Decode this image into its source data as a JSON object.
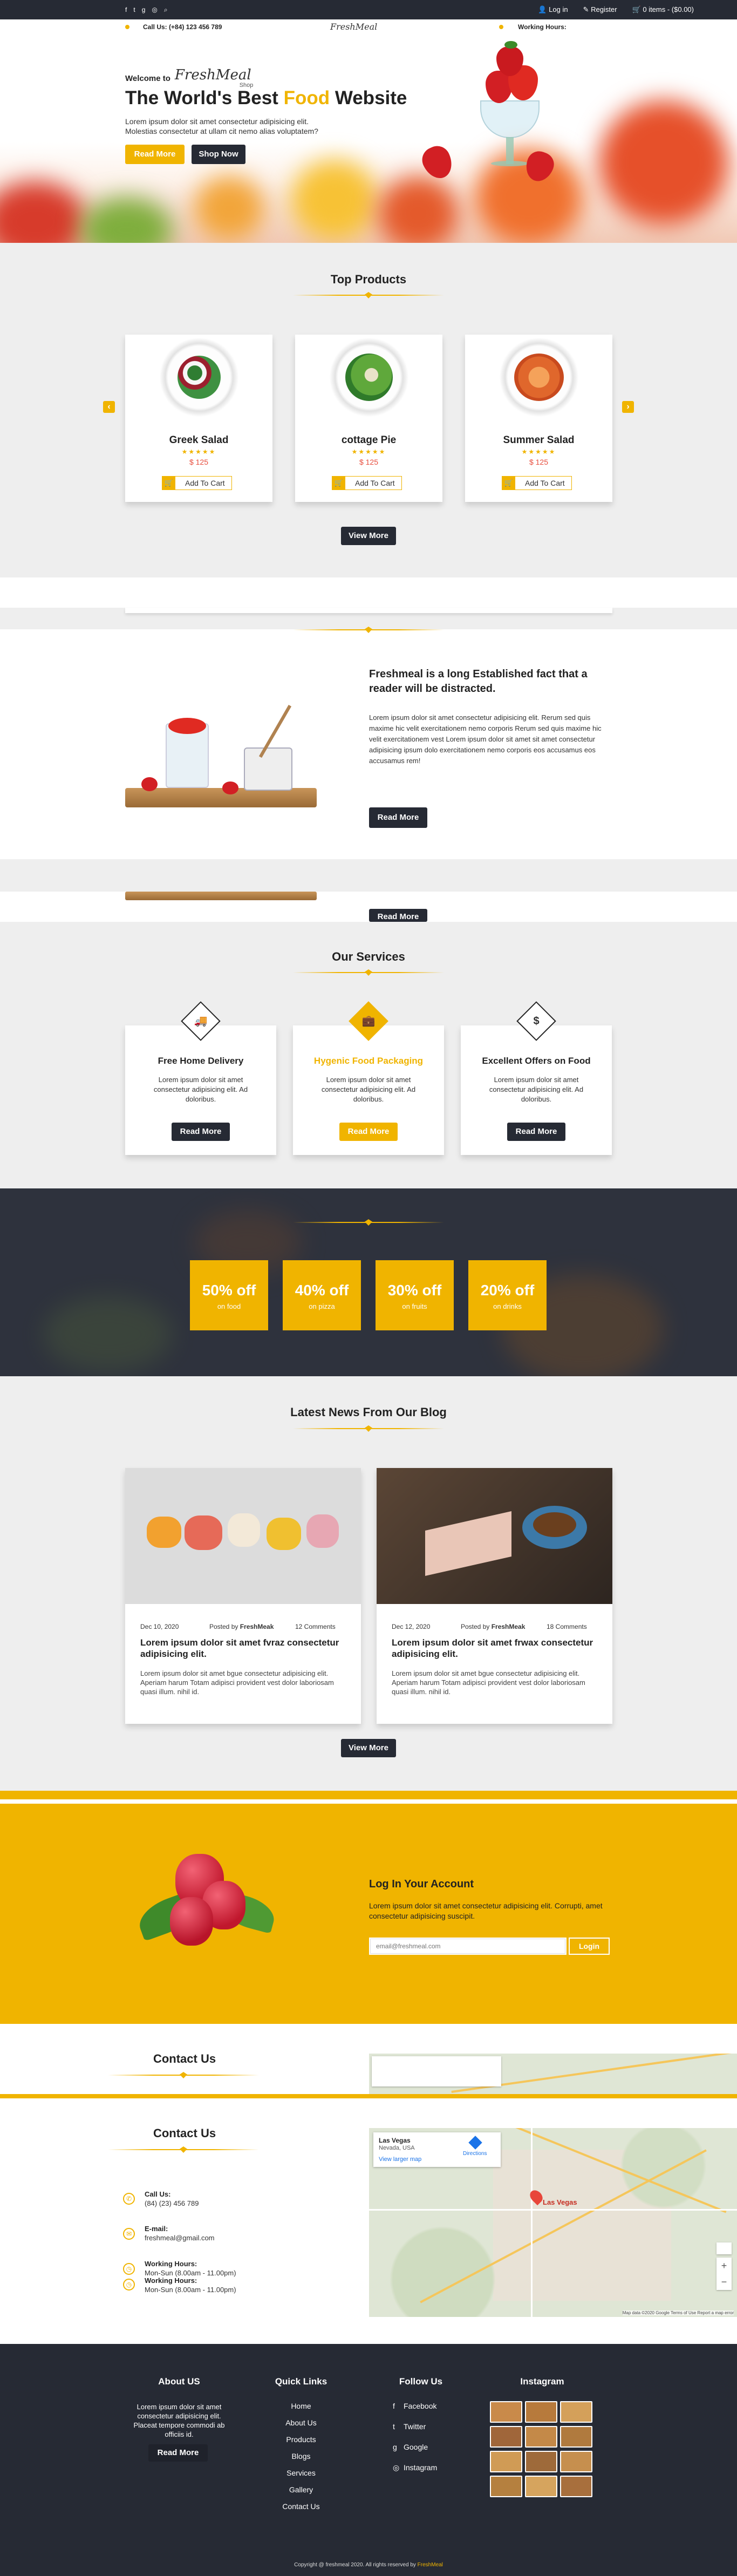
{
  "topbar": {
    "login": "Log in",
    "register": "Register",
    "cart": "0 items - ($0.00)"
  },
  "header": {
    "call_label": "Call Us: (+84) 123 456 789",
    "logo": "FreshMeal",
    "working_hours": "Working Hours:"
  },
  "hero": {
    "welcome": "Welcome to",
    "logo_script": "FreshMeal",
    "logo_sub": "Shop",
    "title_1": "The World's Best ",
    "title_food": "Food",
    "title_2": " Website",
    "desc": "Lorem ipsum dolor sit amet consectetur adipisicing elit. Molestias consectetur at ullam cit nemo alias voluptatem?",
    "read_more": "Read More",
    "shop_now": "Shop Now"
  },
  "top_products": {
    "title": "Top Products",
    "view_more": "View More",
    "prev": "‹",
    "next": "›",
    "items": [
      {
        "name": "Greek Salad",
        "stars": "★★★★★",
        "price": "$ 125",
        "add": "Add To Cart"
      },
      {
        "name": "cottage Pie",
        "stars": "★★★★★",
        "price": "$ 125",
        "add": "Add To Cart"
      },
      {
        "name": "Summer Salad",
        "stars": "★★★★★",
        "price": "$ 125",
        "add": "Add To Cart"
      }
    ]
  },
  "about": {
    "heading": "Freshmeal is a long Established fact that a reader will be distracted.",
    "body": "Lorem ipsum dolor sit amet consectetur adipisicing elit. Rerum sed quis maxime hic velit exercitationem nemo corporis Rerum sed quis maxime hic velit exercitationem vest Lorem ipsum dolor sit amet sit amet consectetur adipisicing ipsum dolo exercitationem nemo corporis eos accusamus eos accusamus rem!",
    "read_more": "Read More",
    "read_more_dup": "Read More"
  },
  "services": {
    "title": "Our Services",
    "items": [
      {
        "icon": "truck-icon",
        "glyph": "🚚",
        "title": "Free Home Delivery",
        "desc": "Lorem ipsum dolor sit amet consectetur adipisicing elit. Ad doloribus.",
        "button": "Read More"
      },
      {
        "icon": "briefcase-icon",
        "glyph": "💼",
        "title": "Hygenic Food Packaging",
        "desc": "Lorem ipsum dolor sit amet consectetur adipisicing elit. Ad doloribus.",
        "button": "Read More"
      },
      {
        "icon": "dollar-icon",
        "glyph": "$",
        "title": "Excellent Offers on Food",
        "desc": "Lorem ipsum dolor sit amet consectetur adipisicing elit. Ad doloribus.",
        "button": "Read More"
      }
    ]
  },
  "offers": [
    {
      "big": "50% off",
      "small": "on food"
    },
    {
      "big": "40% off",
      "small": "on pizza"
    },
    {
      "big": "30% off",
      "small": "on fruits"
    },
    {
      "big": "20% off",
      "small": "on drinks"
    }
  ],
  "blog": {
    "title": "Latest News From Our Blog",
    "view_more": "View More",
    "posts": [
      {
        "date": "Dec 10, 2020",
        "posted": "Posted by ",
        "author": "FreshMeak",
        "comments": "12 Comments",
        "title": "Lorem ipsum dolor sit amet fvraz consectetur adipisicing elit.",
        "body": "Lorem ipsum dolor sit amet bgue consectetur adipisicing elit. Aperiam harum Totam adipisci provident vest dolor laboriosam quasi illum. nihil id."
      },
      {
        "date": "Dec 12, 2020",
        "posted": "Posted by ",
        "author": "FreshMeak",
        "comments": "18 Comments",
        "title": "Lorem ipsum dolor sit amet frwax consectetur adipisicing elit.",
        "body": "Lorem ipsum dolor sit amet bgue consectetur adipisicing elit. Aperiam harum Totam adipisci provident vest dolor laboriosam quasi illum. nihil id."
      }
    ]
  },
  "login": {
    "title": "Log In Your Account",
    "desc": "Lorem ipsum dolor sit amet consectetur adipisicing elit. Corrupti, amet consectetur adipisicing suscipit.",
    "placeholder": "email@freshmeal.com",
    "button": "Login"
  },
  "contact": {
    "title_top": "Contact Us",
    "title": "Contact Us",
    "call_label": "Call Us:",
    "call_value": "(84) (23) 456 789",
    "email_label": "E-mail:",
    "email_value": "freshmeal@gmail.com",
    "hours_label": "Working Hours:",
    "hours_value": "Mon-Sun (8.00am - 11.00pm)",
    "hours_label2": "Working Hours:",
    "hours_value2": "Mon-Sun (8.00am - 11.00pm)"
  },
  "map": {
    "place": "Las Vegas",
    "address": "Nevada, USA",
    "view_larger": "View larger map",
    "directions": "Directions",
    "city": "Las Vegas",
    "footer": "Map data ©2020 Google   Terms of Use   Report a map error"
  },
  "footer": {
    "about_title": "About US",
    "about_text": "Lorem ipsum dolor sit amet consectetur adipisicing elit. Placeat tempore commodi ab officiis id.",
    "about_button": "Read More",
    "links_title": "Quick Links",
    "links": [
      "Home",
      "About Us",
      "Products",
      "Blogs",
      "Services",
      "Gallery",
      "Contact Us"
    ],
    "follow_title": "Follow Us",
    "follow": [
      {
        "icon": "facebook-icon",
        "glyph": "f",
        "label": "Facebook"
      },
      {
        "icon": "twitter-icon",
        "glyph": "t",
        "label": "Twitter"
      },
      {
        "icon": "google-icon",
        "glyph": "g",
        "label": "Google"
      },
      {
        "icon": "instagram-icon",
        "glyph": "◎",
        "label": "Instagram"
      }
    ],
    "instagram_title": "Instagram",
    "copyright": "Copyright @ freshmeal 2020. All rights reserved by ",
    "copyright_brand": "FreshMeal"
  },
  "colors": {
    "accent": "#f0b400",
    "dark": "#262a34",
    "gray": "#eeeeee"
  }
}
